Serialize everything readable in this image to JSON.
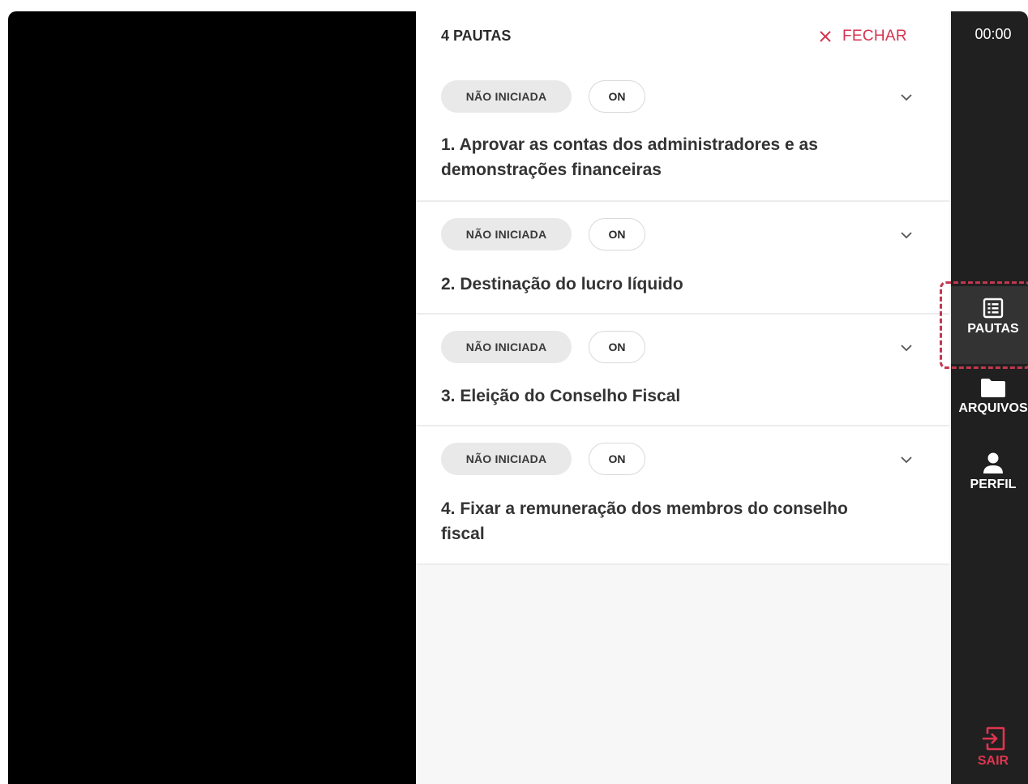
{
  "panel": {
    "title": "4 PAUTAS",
    "close_label": "FECHAR",
    "items": [
      {
        "status": "NÃO INICIADA",
        "mode": "ON",
        "title": "1. Aprovar as contas dos administradores e as demonstrações financeiras"
      },
      {
        "status": "NÃO INICIADA",
        "mode": "ON",
        "title": "2. Destinação do lucro líquido"
      },
      {
        "status": "NÃO INICIADA",
        "mode": "ON",
        "title": "3. Eleição do Conselho Fiscal"
      },
      {
        "status": "NÃO INICIADA",
        "mode": "ON",
        "title": "4. Fixar a remuneração dos membros do conselho fiscal"
      }
    ]
  },
  "sidebar": {
    "timer": "00:00",
    "nav": [
      {
        "label": "PAUTAS",
        "icon": "list-icon",
        "active": true
      },
      {
        "label": "ARQUIVOS",
        "icon": "folder-icon",
        "active": false
      },
      {
        "label": "PERFIL",
        "icon": "user-icon",
        "active": false
      }
    ],
    "exit_label": "SAIR"
  },
  "colors": {
    "accent": "#d6334f",
    "sidebar_bg": "#202020",
    "highlight": "#c2384f"
  }
}
